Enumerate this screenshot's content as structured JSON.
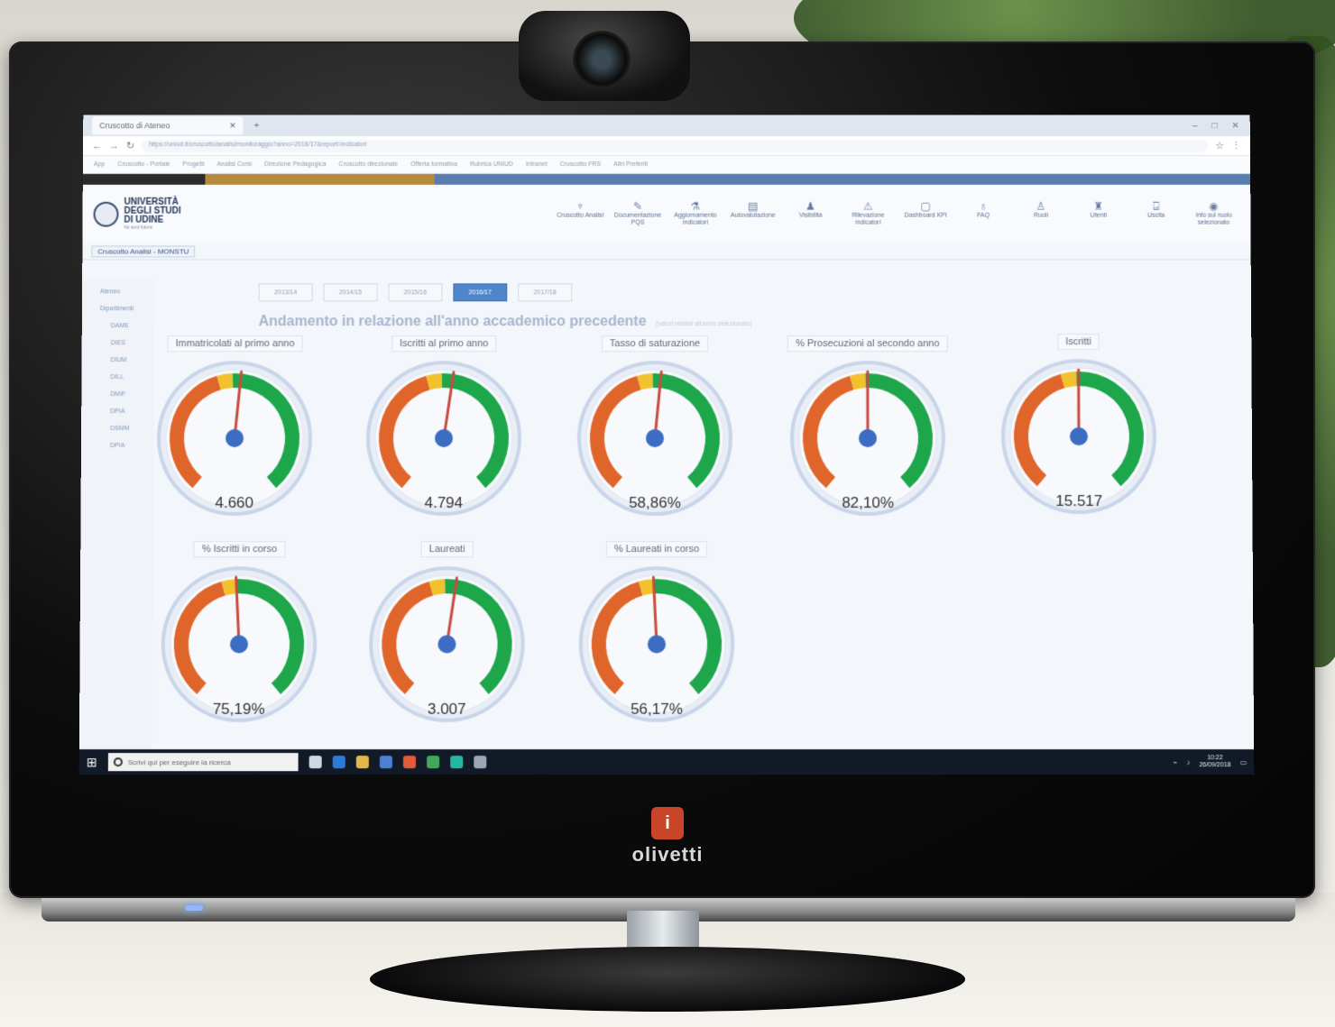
{
  "browser": {
    "tab_title": "Cruscotto di Ateneo",
    "url": "https://uniud.it/cruscotto/analisi/monitoraggio?anno=2016/17&report=indicatori"
  },
  "bookmarks": [
    "App",
    "Cruscotto - Portale",
    "Progetti",
    "Analisi Corsi",
    "Direzione Pedagogica",
    "Cruscotto direzionale",
    "Offerta formativa",
    "Rubrica UNIUD",
    "Intranet",
    "Cruscotto FRS",
    "Altri Preferiti"
  ],
  "university": {
    "line1": "UNIVERSITÀ",
    "line2": "DEGLI STUDI",
    "line3": "DI UDINE",
    "sub": "hic sunt futura"
  },
  "toolbar": [
    {
      "icon": "chart-icon",
      "glyph": "♆",
      "label": "Cruscotto Analisi"
    },
    {
      "icon": "document-icon",
      "glyph": "✎",
      "label": "Documentazione PQS"
    },
    {
      "icon": "update-icon",
      "glyph": "⚗",
      "label": "Aggiornamento indicatori"
    },
    {
      "icon": "form-icon",
      "glyph": "▤",
      "label": "Autovalutazione"
    },
    {
      "icon": "user-icon",
      "glyph": "♟",
      "label": "Visibilità"
    },
    {
      "icon": "report-icon",
      "glyph": "⚠",
      "label": "Rilevazione indicatori"
    },
    {
      "icon": "monitor-icon",
      "glyph": "▢",
      "label": "Dashboard KPI"
    },
    {
      "icon": "faq-icon",
      "glyph": "♁",
      "label": "FAQ"
    },
    {
      "icon": "roles-icon",
      "glyph": "♙",
      "label": "Ruoli"
    },
    {
      "icon": "users-icon",
      "glyph": "♜",
      "label": "Utenti"
    },
    {
      "icon": "logout-icon",
      "glyph": "⍈",
      "label": "Uscita"
    },
    {
      "icon": "profile-icon",
      "glyph": "◉",
      "label": "Info sul ruolo selezionato"
    }
  ],
  "breadcrumb": "Cruscotto Analisi - MONSTU",
  "sidebar": {
    "items": [
      "Ateneo",
      "Dipartimenti"
    ],
    "subitems": [
      "DAME",
      "DIES",
      "DIUM",
      "DILL",
      "DMIF",
      "DPIA",
      "DSMM",
      "DPIA"
    ]
  },
  "years": [
    "2013/14",
    "2014/15",
    "2015/16",
    "2016/17",
    "2017/18"
  ],
  "active_year": "2016/17",
  "heading": "Andamento in relazione all'anno accademico precedente",
  "heading_note": "(valori relativi all'anno selezionato)",
  "colors": {
    "red": "#e0652a",
    "yellow": "#f2c22c",
    "green": "#1ea64b",
    "needle": "#c94a40",
    "hub": "#3c6dc2",
    "ring": "#c8d5ea"
  },
  "gauges": [
    {
      "label": "Immatricolati al primo anno",
      "value": "4.660",
      "needle_level": 0.52
    },
    {
      "label": "Iscritti al primo anno",
      "value": "4.794",
      "needle_level": 0.53
    },
    {
      "label": "Tasso di saturazione",
      "value": "58,86%",
      "needle_level": 0.52
    },
    {
      "label": "% Prosecuzioni al secondo anno",
      "value": "82,10%",
      "needle_level": 0.5
    },
    {
      "label": "Iscritti",
      "value": "15.517",
      "needle_level": 0.5
    },
    {
      "label": "% Iscritti in corso",
      "value": "75,19%",
      "needle_level": 0.49
    },
    {
      "label": "Laureati",
      "value": "3.007",
      "needle_level": 0.53
    },
    {
      "label": "% Laureati in corso",
      "value": "56,17%",
      "needle_level": 0.49
    }
  ],
  "taskbar": {
    "search_placeholder": "Scrivi qui per eseguire la ricerca",
    "time": "10:22",
    "date": "26/09/2018"
  },
  "monitor_brand": "olivetti",
  "monitor_logo": "i"
}
